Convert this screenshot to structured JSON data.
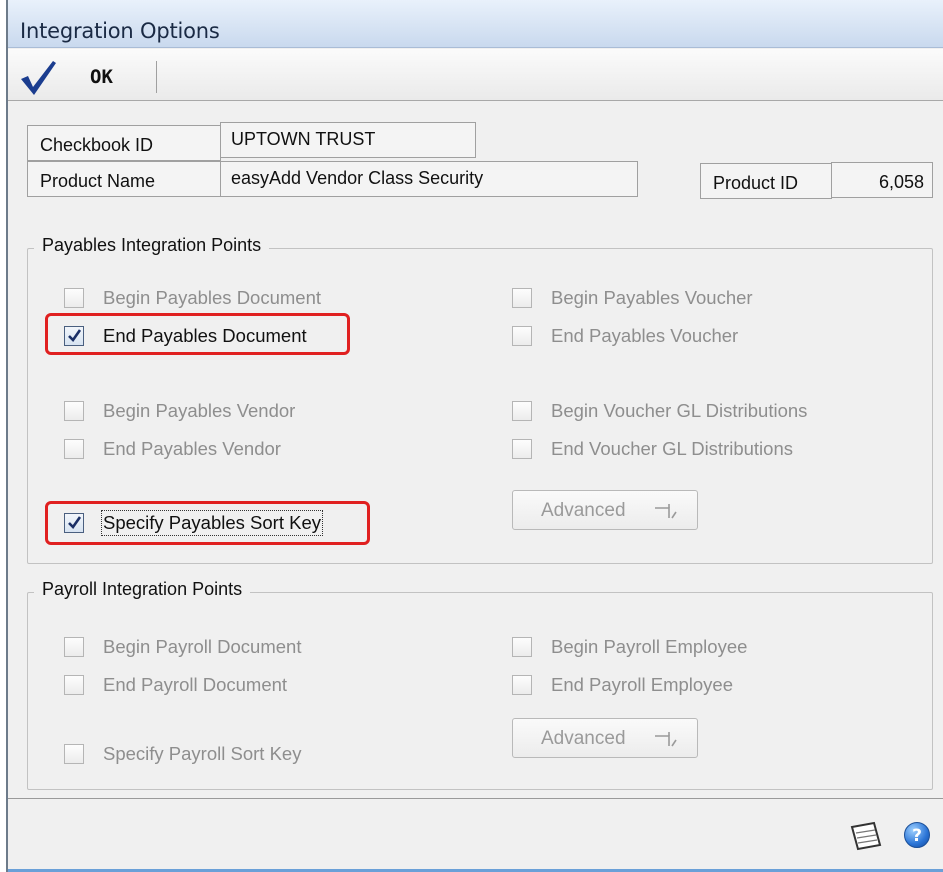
{
  "window": {
    "title": "Integration Options"
  },
  "toolbar": {
    "ok_label": "OK"
  },
  "header": {
    "checkbook_id_label": "Checkbook ID",
    "checkbook_id_value": "UPTOWN TRUST",
    "product_name_label": "Product Name",
    "product_name_value": "easyAdd Vendor Class Security",
    "product_id_label": "Product ID",
    "product_id_value": "6,058"
  },
  "payables": {
    "group_title": "Payables Integration Points",
    "items": [
      {
        "label": "Begin Payables Document",
        "checked": false,
        "enabled": false
      },
      {
        "label": "End Payables Document",
        "checked": true,
        "enabled": true
      },
      {
        "label": "Begin Payables Vendor",
        "checked": false,
        "enabled": false
      },
      {
        "label": "End Payables Vendor",
        "checked": false,
        "enabled": false
      },
      {
        "label": "Specify Payables Sort Key",
        "checked": true,
        "enabled": true
      },
      {
        "label": "Begin Payables Voucher",
        "checked": false,
        "enabled": false
      },
      {
        "label": "End Payables Voucher",
        "checked": false,
        "enabled": false
      },
      {
        "label": "Begin Voucher GL Distributions",
        "checked": false,
        "enabled": false
      },
      {
        "label": "End Voucher GL Distributions",
        "checked": false,
        "enabled": false
      }
    ],
    "advanced_label": "Advanced"
  },
  "payroll": {
    "group_title": "Payroll Integration Points",
    "items": [
      {
        "label": "Begin Payroll Document",
        "checked": false,
        "enabled": false
      },
      {
        "label": "End Payroll Document",
        "checked": false,
        "enabled": false
      },
      {
        "label": "Specify Payroll Sort Key",
        "checked": false,
        "enabled": false
      },
      {
        "label": "Begin Payroll Employee",
        "checked": false,
        "enabled": false
      },
      {
        "label": "End Payroll Employee",
        "checked": false,
        "enabled": false
      }
    ],
    "advanced_label": "Advanced"
  },
  "colors": {
    "highlight": "#e02020",
    "accent": "#1b3d8f"
  },
  "statusbar": {
    "note_icon": "note-icon",
    "help_icon": "help-icon",
    "help_glyph": "?"
  }
}
